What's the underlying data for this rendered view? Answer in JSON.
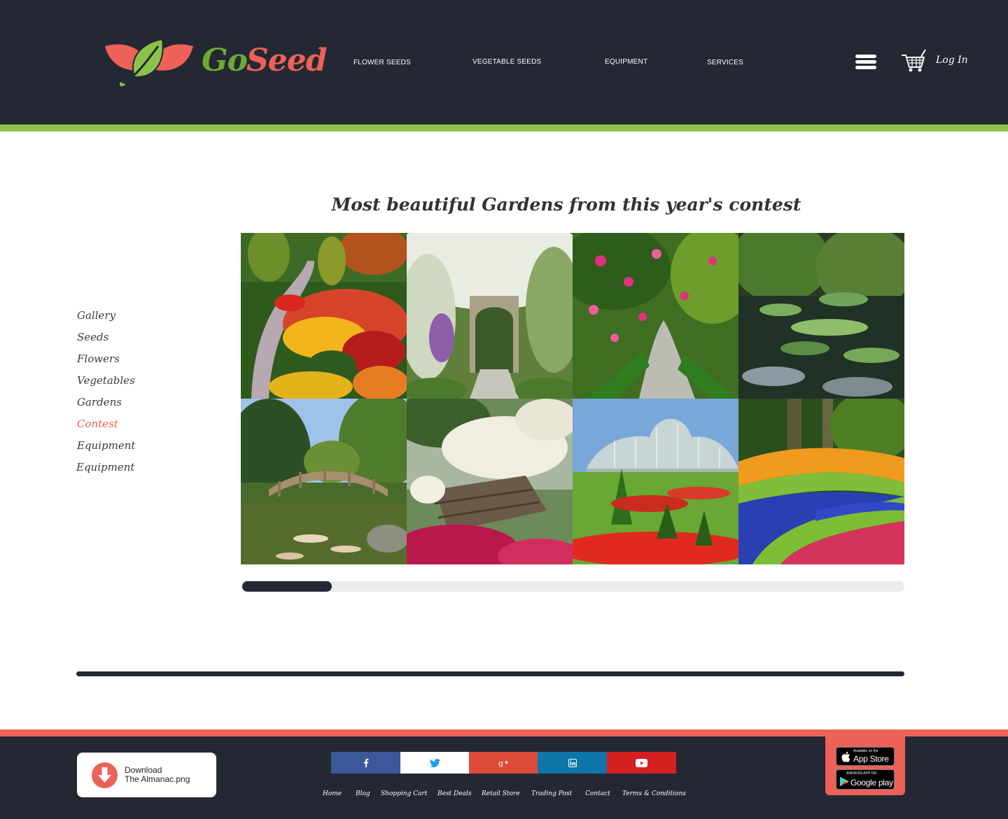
{
  "brand": {
    "name_part1": "Go",
    "name_part2": "Seed"
  },
  "nav": {
    "items": [
      "FLOWER SEEDS",
      "VEGETABLE SEEDS",
      "EQUIPMENT",
      "SERVICES"
    ],
    "login_label": "Log In"
  },
  "sidebar": {
    "items": [
      "Gallery",
      "Seeds",
      "Flowers",
      "Vegetables",
      "Gardens",
      "Contest",
      "Equipment",
      "Equipment"
    ],
    "active_item": "Contest"
  },
  "main": {
    "title": "Most beautiful Gardens from this year's contest",
    "gallery_scroll_position": 0.135
  },
  "footer": {
    "download": {
      "line1": "Download",
      "line2": "The Almanac.png"
    },
    "social": [
      "facebook-icon",
      "twitter-icon",
      "google-plus-icon",
      "linkedin-icon",
      "youtube-icon"
    ],
    "links": [
      "Home",
      "Blog",
      "Shopping Cart",
      "Best Deals",
      "Retail Store",
      "Trading Post",
      "Contact",
      "Terms & Conditions"
    ],
    "app_store": {
      "small": "Available on the",
      "big": "App Store"
    },
    "google_play": {
      "small": "ANDROID APP ON",
      "big": "Google play"
    }
  },
  "colors": {
    "dark": "#242832",
    "green": "#8bc34a",
    "coral": "#ec6158",
    "brand_green": "#6bab35"
  }
}
